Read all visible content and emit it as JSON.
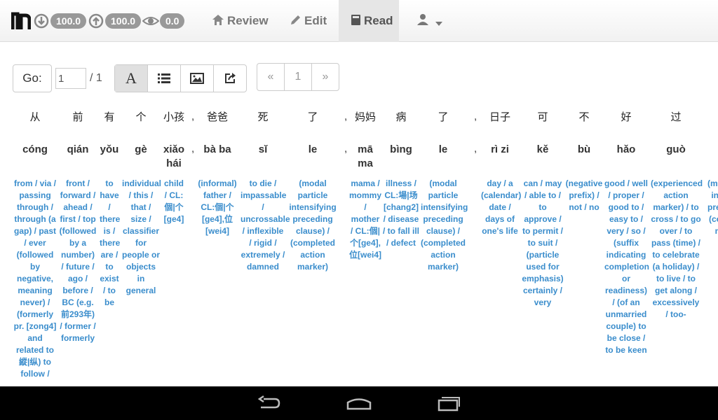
{
  "topbar": {
    "download_stat": "100.0",
    "upload_stat": "100.0",
    "view_stat": "0.0",
    "nav": [
      {
        "label": "Review"
      },
      {
        "label": "Edit"
      },
      {
        "label": "Read"
      }
    ]
  },
  "controls": {
    "go_label": "Go:",
    "page_value": "1",
    "page_total": "/ 1",
    "font_button": "A",
    "pagination": {
      "prev": "«",
      "current": "1",
      "next": "»"
    }
  },
  "reader": {
    "columns": [
      {
        "hanzi": "从",
        "pinyin": "cóng",
        "def": "from / via / passing through / through (a gap) / past / ever (followed by negative, meaning never) / (formerly pr. [zong4] and related to 縱|纵) to follow /"
      },
      {
        "hanzi": "前",
        "pinyin": "qián",
        "def": "front / forward / ahead / first / top (followed by a number) / future / ago / before / BC (e.g. 前293年) / former / formerly"
      },
      {
        "hanzi": "有",
        "pinyin": "yǒu",
        "def": "to have / there is / there are / to exist / to be"
      },
      {
        "hanzi": "个",
        "pinyin": "gè",
        "def": "individual / this / that / size / classifier for people or objects in general"
      },
      {
        "hanzi": "小孩",
        "pinyin": "xiǎo hái",
        "def": "child / CL:個|个 [ge4]"
      },
      {
        "hanzi": "爸爸",
        "pinyin": "bà ba",
        "def": "(informal) father / CL:個|个 [ge4],位 [wei4]"
      },
      {
        "hanzi": "死",
        "pinyin": "sǐ",
        "def": "to die / impassable / uncrossable / inflexible / rigid / extremely / damned"
      },
      {
        "hanzi": "了",
        "pinyin": "le",
        "def": "(modal particle intensifying preceding clause) / (completed action marker)"
      },
      {
        "hanzi": "妈妈",
        "pinyin": "mā ma",
        "def": "mama / mommy / mother / CL:個|个[ge4], 位[wei4]"
      },
      {
        "hanzi": "病",
        "pinyin": "bìng",
        "def": "illness / CL:場|场 [chang2] / disease / to fall ill / defect"
      },
      {
        "hanzi": "了",
        "pinyin": "le",
        "def": "(modal particle intensifying preceding clause) / (completed action marker)"
      },
      {
        "hanzi": "日子",
        "pinyin": "rì zi",
        "def": "day / a (calendar) date / days of one's life"
      },
      {
        "hanzi": "可",
        "pinyin": "kě",
        "def": "can / may / able to / to approve / to permit / to suit / (particle used for emphasis) certainly / very"
      },
      {
        "hanzi": "不",
        "pinyin": "bù",
        "def": "(negative prefix) / not / no"
      },
      {
        "hanzi": "好",
        "pinyin": "hǎo",
        "def": "good / well / proper / good to / easy to / very / so / (suffix indicating completion or readiness) / (of an unmarried couple) to be close / to be keen"
      },
      {
        "hanzi": "过",
        "pinyin": "guò",
        "def": "(experienced action marker) / to cross / to go over / to pass (time) / to celebrate (a holiday) / to live / to get along / excessively / too-"
      },
      {
        "hanzi": "",
        "pinyin": "",
        "def": "(m pa inte pre cl (co a m"
      }
    ],
    "punct": ","
  }
}
